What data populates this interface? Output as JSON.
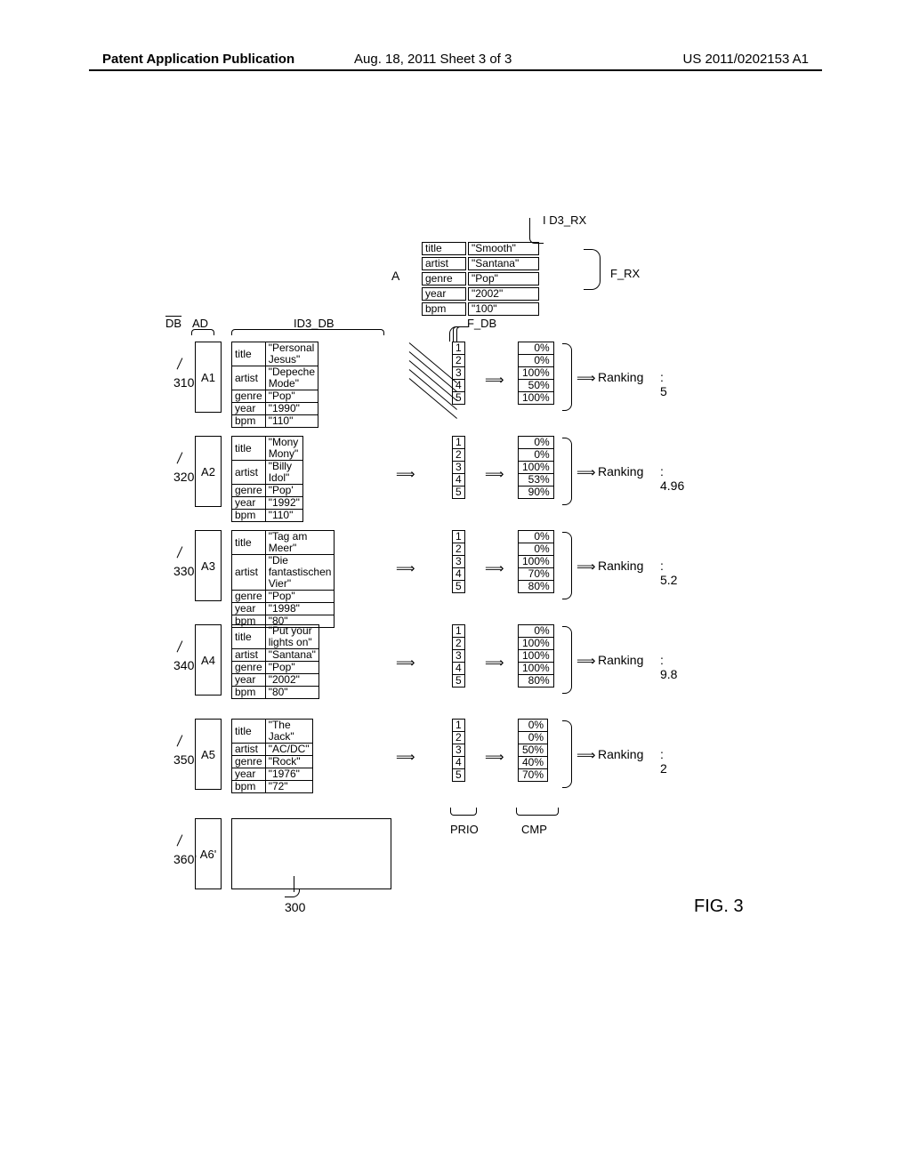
{
  "header": {
    "left": "Patent Application Publication",
    "center": "Aug. 18, 2011  Sheet 3 of 3",
    "right": "US 2011/0202153 A1"
  },
  "labels": {
    "A": "A",
    "ID3_RX": "I D3_RX",
    "F_RX": "F_RX",
    "DB": "DB",
    "AD": "AD",
    "ID3_DB": "ID3_DB",
    "F_DB": "F_DB",
    "PRIO": "PRIO",
    "CMP": "CMP",
    "ref300": "300",
    "fig": "FIG. 3",
    "ranking": "Ranking"
  },
  "received": {
    "fields": [
      {
        "key": "title",
        "val": "\"Smooth\""
      },
      {
        "key": "artist",
        "val": "\"Santana\""
      },
      {
        "key": "genre",
        "val": "\"Pop\""
      },
      {
        "key": "year",
        "val": "\"2002\""
      },
      {
        "key": "bpm",
        "val": "\"100\""
      }
    ]
  },
  "rows": [
    {
      "ref": "310",
      "ad": "A1",
      "meta": [
        [
          "title",
          "\"Personal Jesus\""
        ],
        [
          "artist",
          "\"Depeche Mode\""
        ],
        [
          "genre",
          "\"Pop\""
        ],
        [
          "year",
          "\"1990\""
        ],
        [
          "bpm",
          "\"110\""
        ]
      ],
      "prio": [
        "1",
        "2",
        "3",
        "4",
        "5"
      ],
      "cmp": [
        "0%",
        "0%",
        "100%",
        "50%",
        "100%"
      ],
      "rank": ": 5"
    },
    {
      "ref": "320",
      "ad": "A2",
      "meta": [
        [
          "title",
          "\"Mony Mony\""
        ],
        [
          "artist",
          "\"Billy Idol\""
        ],
        [
          "genre",
          "\"Pop'"
        ],
        [
          "year",
          "\"1992\""
        ],
        [
          "bpm",
          "\"110\""
        ]
      ],
      "prio": [
        "1",
        "2",
        "3",
        "4",
        "5"
      ],
      "cmp": [
        "0%",
        "0%",
        "100%",
        "53%",
        "90%"
      ],
      "rank": ": 4.96"
    },
    {
      "ref": "330",
      "ad": "A3",
      "meta": [
        [
          "title",
          "\"Tag am Meer\""
        ],
        [
          "artist",
          "\"Die fantastischen Vier\""
        ],
        [
          "genre",
          "\"Pop\""
        ],
        [
          "year",
          "\"1998\""
        ],
        [
          "bpm",
          "\"80\""
        ]
      ],
      "prio": [
        "1",
        "2",
        "3",
        "4",
        "5"
      ],
      "cmp": [
        "0%",
        "0%",
        "100%",
        "70%",
        "80%"
      ],
      "rank": ": 5.2"
    },
    {
      "ref": "340",
      "ad": "A4",
      "meta": [
        [
          "title",
          "\"Put your lights on\""
        ],
        [
          "artist",
          "\"Santana\""
        ],
        [
          "genre",
          "\"Pop\""
        ],
        [
          "year",
          "\"2002\""
        ],
        [
          "bpm",
          "\"80\""
        ]
      ],
      "prio": [
        "1",
        "2",
        "3",
        "4",
        "5"
      ],
      "cmp": [
        "0%",
        "100%",
        "100%",
        "100%",
        "80%"
      ],
      "rank": ": 9.8"
    },
    {
      "ref": "350",
      "ad": "A5",
      "meta": [
        [
          "title",
          "\"The Jack\""
        ],
        [
          "artist",
          "\"AC/DC\""
        ],
        [
          "genre",
          "\"Rock\""
        ],
        [
          "year",
          "\"1976\""
        ],
        [
          "bpm",
          "\"72\""
        ]
      ],
      "prio": [
        "1",
        "2",
        "3",
        "4",
        "5"
      ],
      "cmp": [
        "0%",
        "0%",
        "50%",
        "40%",
        "70%"
      ],
      "rank": ": 2"
    }
  ],
  "row6": {
    "ref": "360'",
    "ad": "A6'"
  }
}
